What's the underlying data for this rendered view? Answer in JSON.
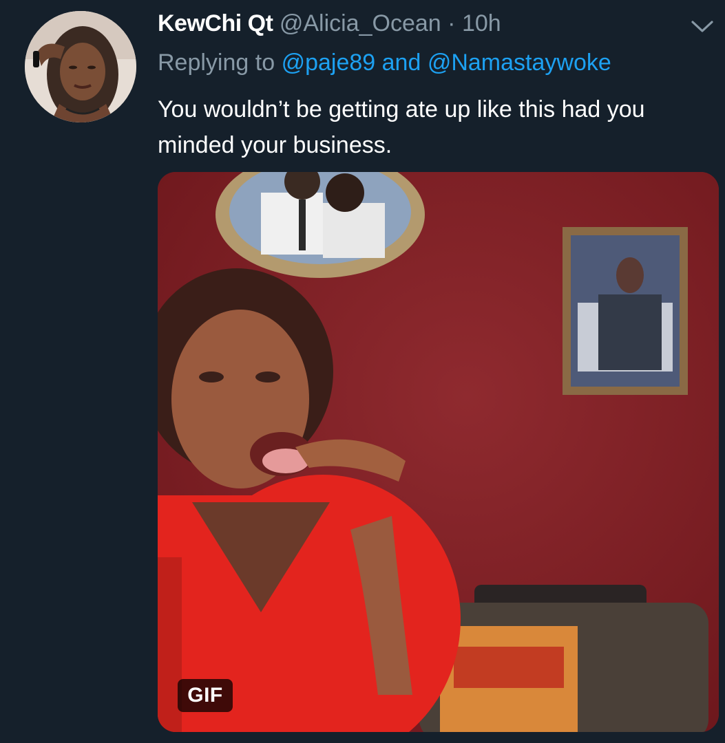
{
  "tweet": {
    "display_name": "KewChi Qt",
    "handle": "@Alicia_Ocean",
    "separator": "·",
    "time": "10h",
    "replying_prefix": "Replying to",
    "reply_mention_1": "@paje89",
    "reply_conjunction": "and",
    "reply_mention_2": "@Namastaywoke",
    "text": "You wouldn’t be getting ate up like this had you minded your business.",
    "media_badge": "GIF"
  },
  "icons": {
    "menu": "chevron-down-icon"
  },
  "colors": {
    "background": "#15202b",
    "secondary_text": "#8899a6",
    "link": "#1da1f2",
    "primary_text": "#ffffff"
  }
}
